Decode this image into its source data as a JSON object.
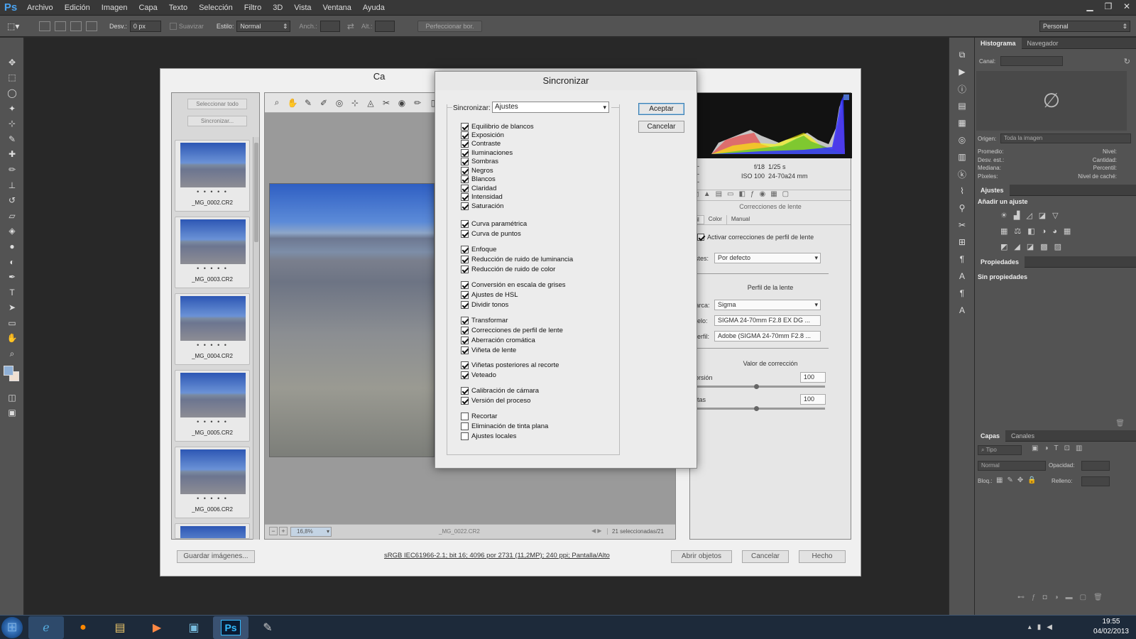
{
  "app": {
    "logo": "Ps"
  },
  "menubar": {
    "items": [
      "Archivo",
      "Edición",
      "Imagen",
      "Capa",
      "Texto",
      "Selección",
      "Filtro",
      "3D",
      "Vista",
      "Ventana",
      "Ayuda"
    ]
  },
  "options_bar": {
    "feather_label": "Desv.:",
    "feather_value": "0 px",
    "smooth_label": "Suavizar",
    "style_label": "Estilo:",
    "style_value": "Normal",
    "width_label": "Anch.:",
    "height_label": "Alt.:",
    "refine_button": "Perfeccionar bor.",
    "workspace": "Personal"
  },
  "right_panels": {
    "histogram_tabs": [
      "Histograma",
      "Navegador"
    ],
    "channel_label": "Canal:",
    "source_label": "Origen:",
    "source_value": "Toda la imagen",
    "stats_left": [
      "Promedio:",
      "Desv. est.:",
      "Mediana:",
      "Píxeles:"
    ],
    "stats_right": [
      "Nivel:",
      "Cantidad:",
      "Percentil:",
      "Nivel de caché:"
    ],
    "adjustments_tab": "Ajustes",
    "add_adjustment": "Añadir un ajuste",
    "properties_tab": "Propiedades",
    "no_properties": "Sin propiedades",
    "layers_tabs": [
      "Capas",
      "Canales"
    ],
    "kind_label": "Tipo",
    "blend_mode": "Normal",
    "opacity_label": "Opacidad:",
    "lock_label": "Bloq.:",
    "fill_label": "Relleno:"
  },
  "camera_raw": {
    "title_fragment": "Ca",
    "select_all": "Seleccionar todo",
    "synchronize": "Sincronizar...",
    "thumbnails": [
      "_MG_0002.CR2",
      "_MG_0003.CR2",
      "_MG_0004.CR2",
      "_MG_0005.CR2",
      "_MG_0006.CR2"
    ],
    "thumb_dots": "• • • • •",
    "zoom": "16,8%",
    "filename": "_MG_0022.CR2",
    "selected_count": "21 seleccionadas/21",
    "exif": {
      "dashes": "---",
      "aperture": "f/18",
      "shutter": "1/25 s",
      "iso": "ISO 100",
      "lens": "24-70a24 mm"
    },
    "panel_title": "Correcciones de lente",
    "tabs": [
      "fil",
      "Color",
      "Manual"
    ],
    "enable_profile": "Activar correcciones de perfil de lente",
    "settings_label": "ustes:",
    "settings_value": "Por defecto",
    "lens_profile_heading": "Perfil de la lente",
    "make_label": "Marca:",
    "make_value": "Sigma",
    "model_label": "odelo:",
    "model_value": "SIGMA 24-70mm F2.8 EX DG ...",
    "profile_label": "Perfil:",
    "profile_value": "Adobe (SIGMA 24-70mm F2.8 ...",
    "correction_heading": "Valor de corrección",
    "distortion_label": "storsión",
    "distortion_value": "100",
    "vignette_label": "ñetas",
    "vignette_value": "100",
    "save_images": "Guardar imágenes...",
    "info_link": "sRGB IEC61966-2.1; bit 16; 4096 por 2731 (11,2MP); 240 ppi; Pantalla/Alto",
    "open_objects": "Abrir objetos",
    "cancel": "Cancelar",
    "done": "Hecho"
  },
  "sync_dialog": {
    "title": "Sincronizar",
    "sync_label": "Sincronizar:",
    "sync_value": "Ajustes",
    "ok": "Aceptar",
    "cancel": "Cancelar",
    "groups": [
      [
        {
          "label": "Equilibrio de blancos",
          "checked": true
        },
        {
          "label": "Exposición",
          "checked": true
        },
        {
          "label": "Contraste",
          "checked": true
        },
        {
          "label": "Iluminaciones",
          "checked": true
        },
        {
          "label": "Sombras",
          "checked": true
        },
        {
          "label": "Negros",
          "checked": true
        },
        {
          "label": "Blancos",
          "checked": true
        },
        {
          "label": "Claridad",
          "checked": true
        },
        {
          "label": "Intensidad",
          "checked": true
        },
        {
          "label": "Saturación",
          "checked": true
        }
      ],
      [
        {
          "label": "Curva paramétrica",
          "checked": true
        },
        {
          "label": "Curva de puntos",
          "checked": true
        }
      ],
      [
        {
          "label": "Enfoque",
          "checked": true
        },
        {
          "label": "Reducción de ruido de luminancia",
          "checked": true
        },
        {
          "label": "Reducción de ruido de color",
          "checked": true
        }
      ],
      [
        {
          "label": "Conversión en escala de grises",
          "checked": true
        },
        {
          "label": "Ajustes de HSL",
          "checked": true
        },
        {
          "label": "Dividir tonos",
          "checked": true
        }
      ],
      [
        {
          "label": "Transformar",
          "checked": true
        },
        {
          "label": "Correcciones de perfil de lente",
          "checked": true
        },
        {
          "label": "Aberración cromática",
          "checked": true
        },
        {
          "label": "Viñeta de lente",
          "checked": true
        }
      ],
      [
        {
          "label": "Viñetas posteriores al recorte",
          "checked": true
        },
        {
          "label": "Veteado",
          "checked": true
        }
      ],
      [
        {
          "label": "Calibración de cámara",
          "checked": true
        },
        {
          "label": "Versión del proceso",
          "checked": true
        }
      ],
      [
        {
          "label": "Recortar",
          "checked": false
        },
        {
          "label": "Eliminación de tinta plana",
          "checked": false
        },
        {
          "label": "Ajustes locales",
          "checked": false
        }
      ]
    ]
  },
  "taskbar": {
    "time": "19:55",
    "date": "04/02/2013"
  }
}
